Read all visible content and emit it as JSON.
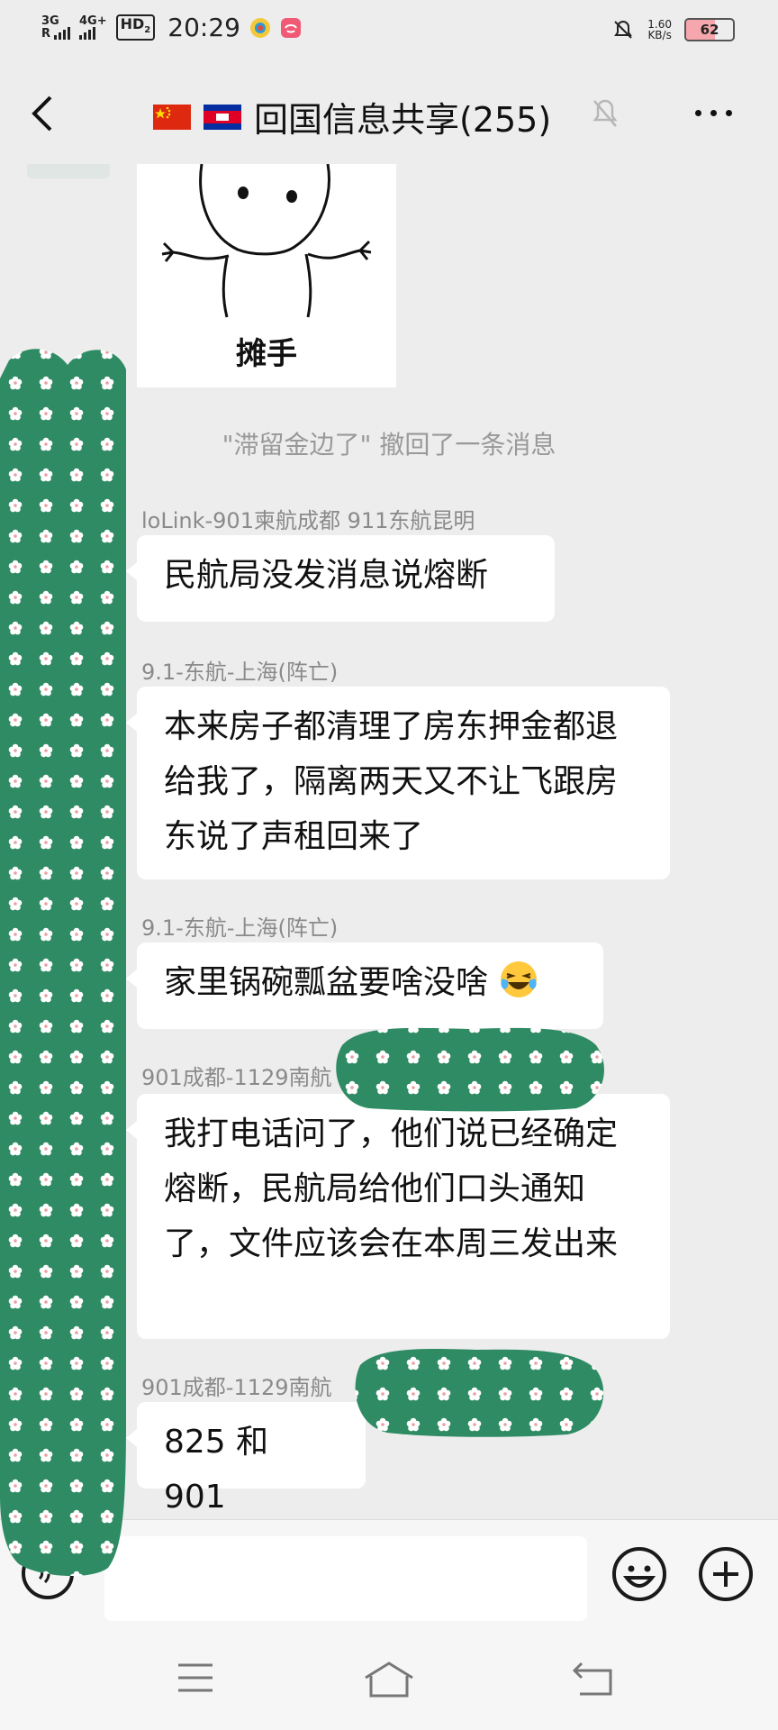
{
  "status_bar": {
    "sim1": "3G",
    "sim1_roaming": "R",
    "sim2": "4G+",
    "hd_label": "HD",
    "hd_sub": "2",
    "time": "20:29",
    "speed_value": "1.60",
    "speed_unit": "KB/s",
    "battery": "62",
    "icons": [
      "signal-icon",
      "hd-voice-icon",
      "app-notification-icon",
      "app-notification-icon-2",
      "do-not-disturb-icon",
      "battery-icon"
    ]
  },
  "header": {
    "title": "回国信息共享(255)",
    "flags": [
      "china-flag-icon",
      "cambodia-flag-icon"
    ],
    "icons": [
      "back-arrow-icon",
      "mute-bell-icon",
      "more-icon"
    ]
  },
  "sticker": {
    "caption": "摊手"
  },
  "system_message": "\"滞留金边了\" 撤回了一条消息",
  "messages": [
    {
      "sender": "loLink-901柬航成都 911东航昆明",
      "text": "民航局没发消息说熔断"
    },
    {
      "sender": "9.1-东航-上海(阵亡)",
      "text": "本来房子都清理了房东押金都退给我了，隔离两天又不让飞跟房东说了声租回来了"
    },
    {
      "sender": "9.1-东航-上海(阵亡)",
      "text": "家里锅碗瓢盆要啥没啥",
      "emoji": "laughing-crying-emoji-icon"
    },
    {
      "sender": "901成都-1129南航",
      "text": "我打电话问了，他们说已经确定熔断，民航局给他们口头通知了，文件应该会在本周三发出来"
    },
    {
      "sender": "901成都-1129南航",
      "text": "825 和 901"
    }
  ],
  "input_bar": {
    "input_value": "",
    "icons": [
      "voice-icon",
      "emoji-icon",
      "plus-icon"
    ]
  },
  "nav_bar": {
    "icons": [
      "menu-icon",
      "home-icon",
      "back-icon"
    ]
  },
  "colors": {
    "background": "#ededed",
    "bubble": "#ffffff",
    "redaction_green": "#2e8b63",
    "text": "#111111",
    "meta_text": "#8a8a8a"
  }
}
